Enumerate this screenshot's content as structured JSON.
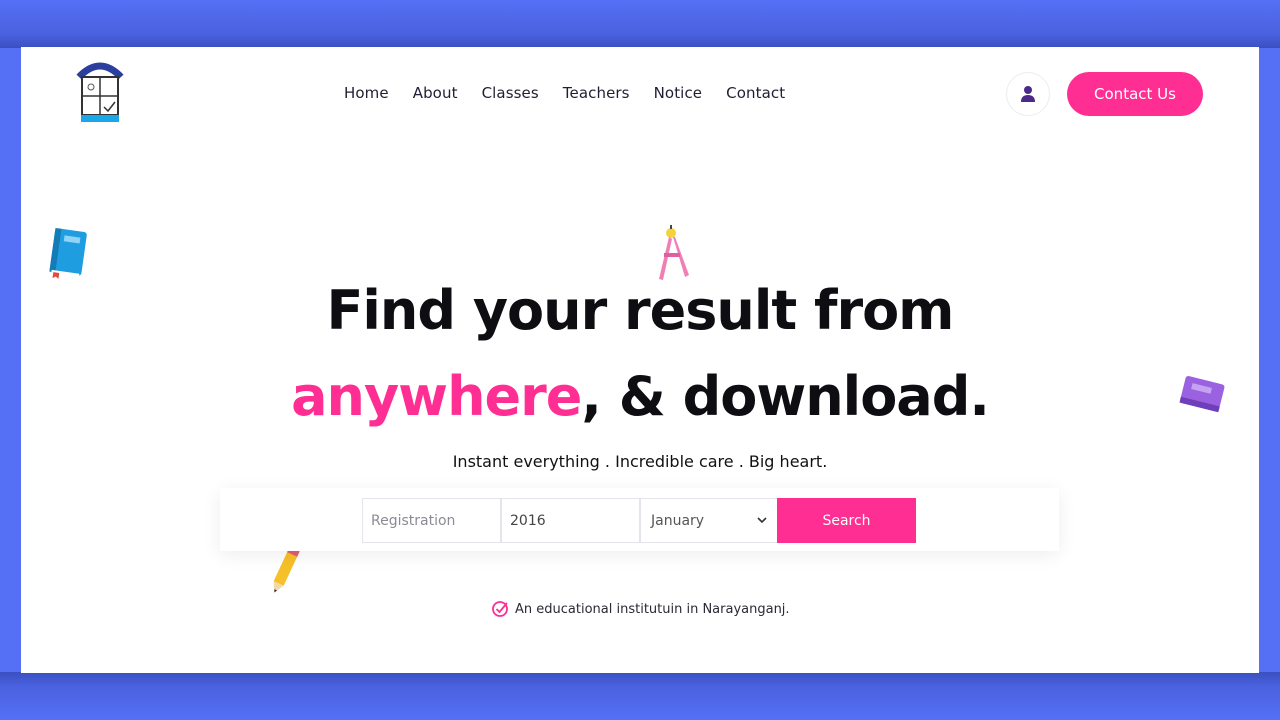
{
  "nav": {
    "items": [
      "Home",
      "About",
      "Classes",
      "Teachers",
      "Notice",
      "Contact"
    ]
  },
  "header": {
    "contact_button": "Contact Us",
    "user_icon": "user-icon"
  },
  "hero": {
    "line1": "Find your result from",
    "line2_accent": "anywhere",
    "line2_rest": ", & download.",
    "tagline": "Instant everything . Incredible care . Big heart."
  },
  "search": {
    "registration_placeholder": "Registration",
    "year_value": "2016",
    "month_selected": "January",
    "button": "Search"
  },
  "footer_note": {
    "text": "An educational institutuin in Narayanganj."
  },
  "colors": {
    "accent": "#ff2e93",
    "frame": "#5570f5"
  }
}
